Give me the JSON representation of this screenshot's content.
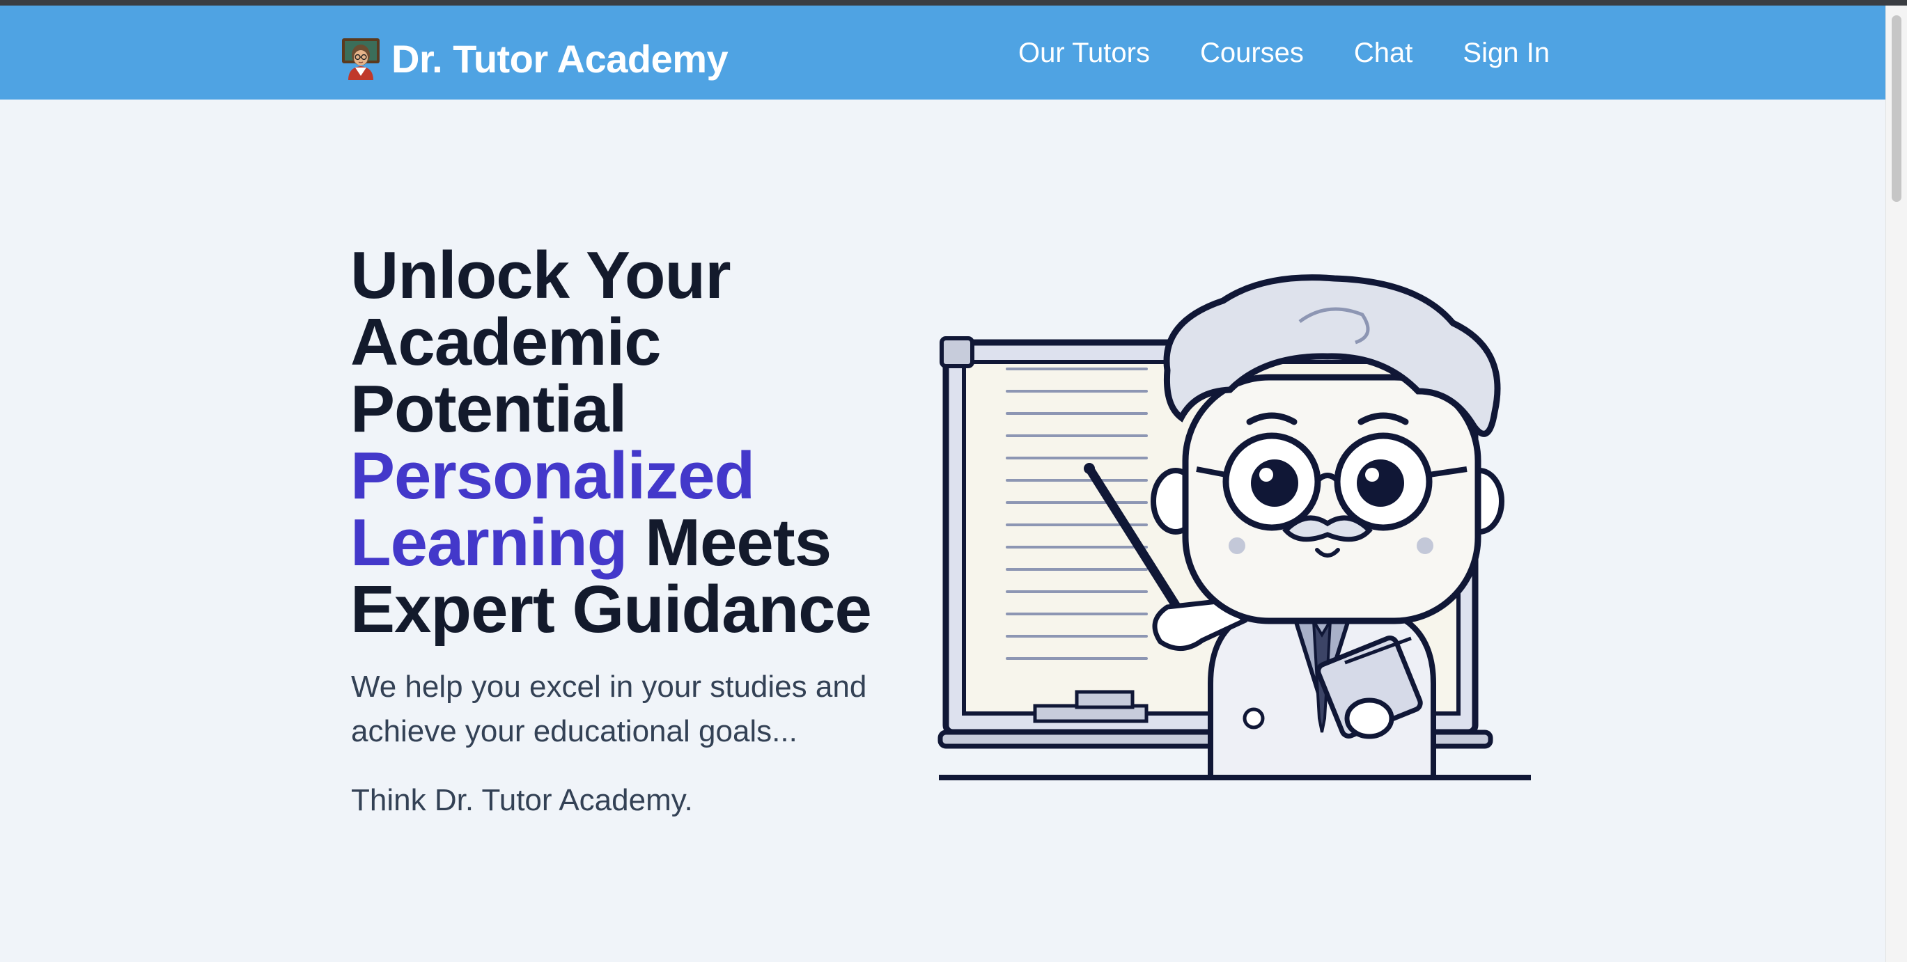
{
  "header": {
    "brand_name": "Dr. Tutor Academy",
    "brand_icon": "teacher-emoji-icon",
    "nav": [
      {
        "label": "Our Tutors"
      },
      {
        "label": "Courses"
      },
      {
        "label": "Chat"
      },
      {
        "label": "Sign In"
      }
    ]
  },
  "hero": {
    "title_line1": "Unlock Your Academic Potential",
    "title_accent": "Personalized Learning",
    "title_line2": "Meets Expert Guidance",
    "subtitle": "We help you excel in your studies and achieve your educational goals...",
    "tagline": "Think Dr. Tutor Academy.",
    "illustration": "cartoon-professor-at-whiteboard"
  },
  "colors": {
    "navbar": "#4fa3e3",
    "page_background": "#f0f4f9",
    "heading": "#131a2c",
    "accent": "#4338ca",
    "body_text": "#334155"
  }
}
